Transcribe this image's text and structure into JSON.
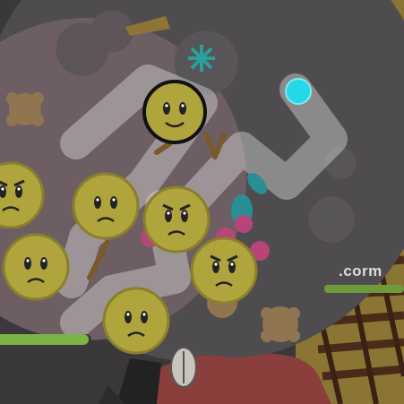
{
  "hud": {
    "brand_text": ".corm",
    "left_health_fraction": 0.97
  },
  "colors": {
    "dark_disc": "#4e4c4e",
    "inner_disc": "#6d5e63",
    "outer_world": "#3f3d40",
    "sandy_ground": "#8f7b37",
    "creature_yellow": "#b4a83f",
    "player_cyan": "#26d7e6",
    "path_overlay": "rgba(220,220,220,0.45)",
    "berry_pink": "#c0477a",
    "leaf_teal": "#2a9c9e",
    "health_green": "#7cb342"
  },
  "entities": {
    "player_icon": "cyan-orb-icon",
    "creature_icon": "smiley-creature-icon",
    "food_icons": [
      "cookie-icon",
      "berry-icon",
      "leaf-icon",
      "sea-urchin-icon",
      "twig-icon",
      "seed-pod-icon"
    ]
  }
}
